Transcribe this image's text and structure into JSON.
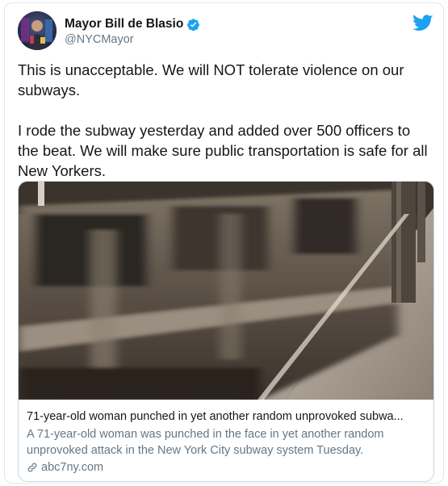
{
  "user": {
    "display_name": "Mayor Bill de Blasio",
    "handle": "@NYCMayor",
    "verified": true
  },
  "tweet": {
    "text": "This is unacceptable. We will NOT tolerate violence on our subways.\n\nI rode the subway yesterday and added over 500 officers to the beat. We will make sure public transportation is safe for all New Yorkers."
  },
  "card": {
    "title": "71-year-old woman punched in yet another random unprovoked subwa...",
    "description": "A 71-year-old woman was punched in the face in yet another random unprovoked attack in the New York City subway system Tuesday.",
    "domain": "abc7ny.com"
  },
  "colors": {
    "twitter_blue": "#1da1f2",
    "secondary_text": "#657786",
    "border": "#e1e8ed"
  },
  "icons": {
    "logo": "twitter-bird-icon",
    "verified": "verified-badge-icon",
    "link": "link-icon"
  }
}
